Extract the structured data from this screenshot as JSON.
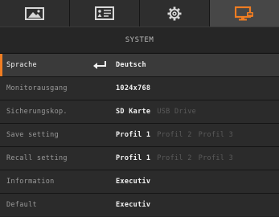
{
  "tabs": [
    {
      "icon": "image-icon",
      "active": false
    },
    {
      "icon": "presentation-icon",
      "active": false
    },
    {
      "icon": "gear-icon",
      "active": false
    },
    {
      "icon": "monitor-icon",
      "active": true
    }
  ],
  "section_title": "SYSTEM",
  "accent_color": "#f07d22",
  "rows": [
    {
      "label": "Sprache",
      "values": [
        "Deutsch"
      ],
      "selected": true
    },
    {
      "label": "Monitorausgang",
      "values": [
        "1024x768"
      ]
    },
    {
      "label": "Sicherungskop.",
      "values": [
        "SD Karte",
        "USB Drive"
      ]
    },
    {
      "label": "Save setting",
      "values": [
        "Profil 1",
        "Profil 2",
        "Profil 3"
      ]
    },
    {
      "label": "Recall setting",
      "values": [
        "Profil 1",
        "Profil 2",
        "Profil 3"
      ]
    },
    {
      "label": "Information",
      "values": [
        "Executiv"
      ]
    },
    {
      "label": "Default",
      "values": [
        "Executiv"
      ]
    }
  ]
}
